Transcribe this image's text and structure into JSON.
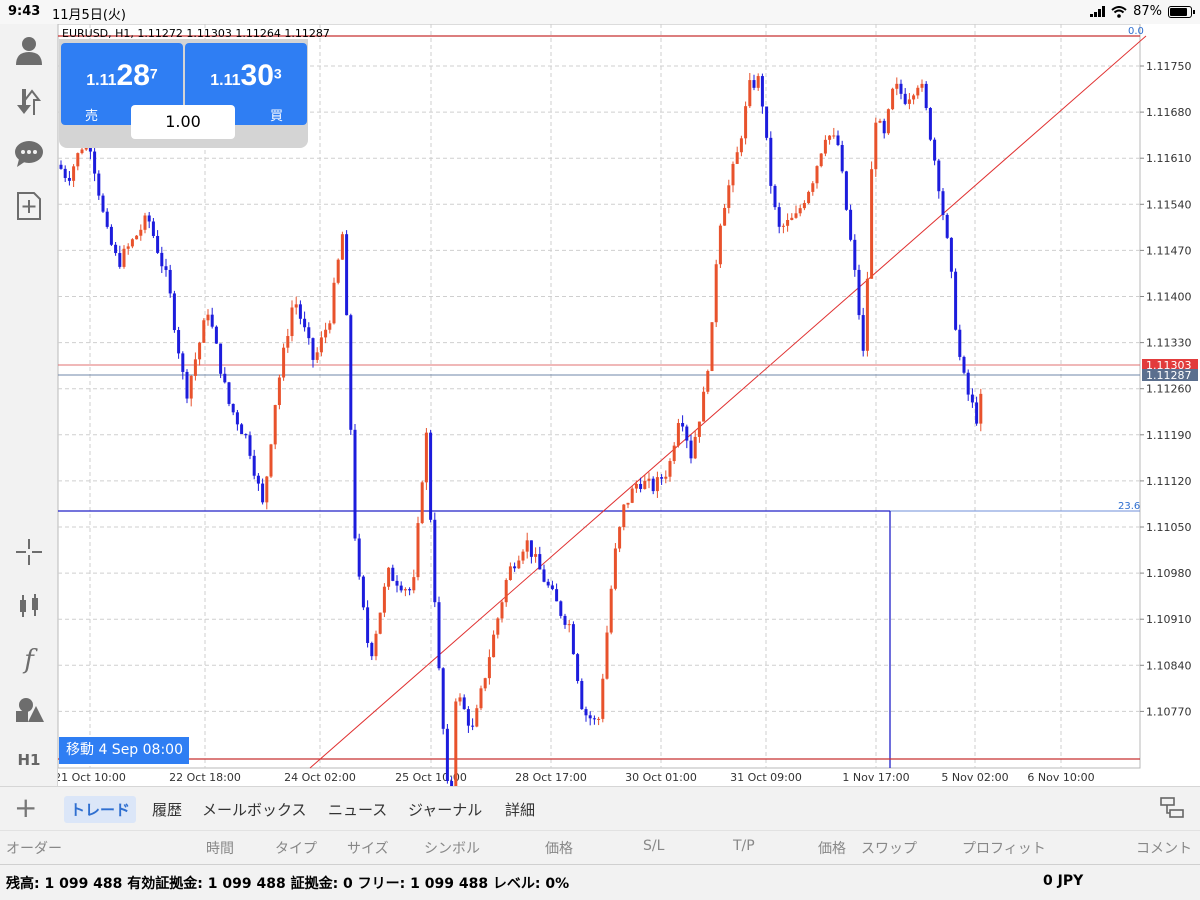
{
  "status_bar": {
    "time": "9:43",
    "date": "11月5日(火)",
    "battery": "87%"
  },
  "chart": {
    "title": "EURUSD, H1, 1.11272 1.11303 1.11264 1.11287",
    "y_ticks": [
      "1.11750",
      "1.11680",
      "1.11610",
      "1.11540",
      "1.11470",
      "1.11400",
      "1.11330",
      "1.11260",
      "1.11190",
      "1.11120",
      "1.11050",
      "1.10980",
      "1.10910",
      "1.10840",
      "1.10770"
    ],
    "x_ticks": [
      "21 Oct 10:00",
      "22 Oct 18:00",
      "24 Oct 02:00",
      "25 Oct 10:00",
      "28 Oct 17:00",
      "30 Oct 01:00",
      "31 Oct 09:00",
      "1 Nov 17:00",
      "5 Nov 02:00",
      "6 Nov 10:00"
    ],
    "ask_label": "1.11303",
    "bid_label": "1.11287",
    "fib_top_label": "0.0",
    "fib_mid_label": "23.6",
    "colors": {
      "bull": "#e8522c",
      "bear": "#1c1cdc",
      "ask_line": "#e07070",
      "bid_line": "#6f87a8",
      "trend": "#e03030",
      "fib_blue": "#2020c8",
      "fib_red": "#c83030"
    }
  },
  "trade_widget": {
    "sell": {
      "small": "1.11",
      "big": "28",
      "sup": "7",
      "label": "売"
    },
    "buy": {
      "small": "1.11",
      "big": "30",
      "sup": "3",
      "label": "買"
    },
    "lot": "1.00"
  },
  "move_label": "移動 4 Sep 08:00",
  "sidebar": {
    "timeframe": "H1"
  },
  "tabs": {
    "trade": "トレード",
    "history": "履歴",
    "mailbox": "メールボックス",
    "news": "ニュース",
    "journal": "ジャーナル",
    "details": "詳細"
  },
  "columns": {
    "order": "オーダー",
    "time": "時間",
    "type": "タイプ",
    "size": "サイズ",
    "symbol": "シンボル",
    "price": "価格",
    "sl": "S/L",
    "tp": "T/P",
    "price2": "価格",
    "swap": "スワップ",
    "profit": "プロフィット",
    "comment": "コメント"
  },
  "balance": {
    "text": "残高: 1 099 488 有効証拠金: 1 099 488 証拠金: 0 フリー: 1 099 488 レベル: 0%",
    "profit": "0  JPY"
  }
}
